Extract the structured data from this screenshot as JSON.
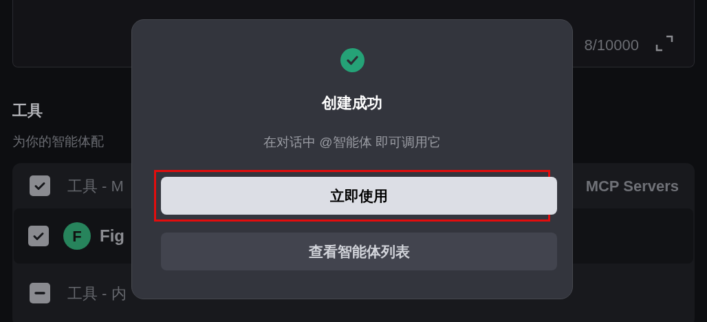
{
  "editor": {
    "char_count": "8/10000"
  },
  "tools": {
    "heading": "工具",
    "description": "为你的智能体配",
    "items": [
      {
        "kind": "group",
        "label": "工具 - M",
        "label_end": "MCP Servers",
        "checked": true
      },
      {
        "kind": "tool",
        "avatar": "F",
        "name": "Fig",
        "checked": true
      },
      {
        "kind": "group",
        "label": "工具 - 内",
        "indeterminate": true
      }
    ]
  },
  "dialog": {
    "title": "创建成功",
    "message": "在对话中 @智能体 即可调用它",
    "buttons": [
      {
        "label": "立即使用",
        "kind": "primary",
        "highlighted": true
      },
      {
        "label": "查看智能体列表",
        "kind": "secondary",
        "highlighted": false
      }
    ]
  }
}
